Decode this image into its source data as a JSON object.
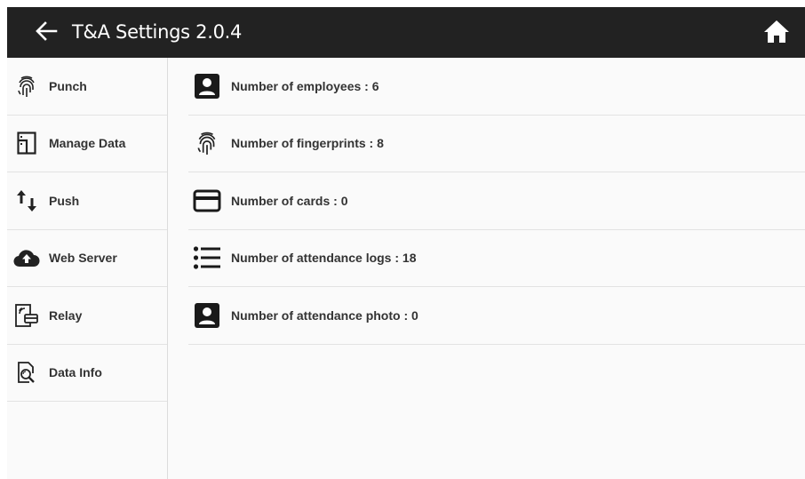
{
  "header": {
    "title": "T&A Settings 2.0.4",
    "back_icon": "arrow-left-icon",
    "home_icon": "home-icon",
    "background": "#222222"
  },
  "sidebar": {
    "items": [
      {
        "label": "Punch",
        "icon": "fingerprint-icon"
      },
      {
        "label": "Manage Data",
        "icon": "storage-icon"
      },
      {
        "label": "Push",
        "icon": "up-down-arrows-icon"
      },
      {
        "label": "Web Server",
        "icon": "cloud-upload-icon"
      },
      {
        "label": "Relay",
        "icon": "door-relay-icon"
      },
      {
        "label": "Data Info",
        "icon": "document-search-icon"
      }
    ]
  },
  "info": {
    "rows": [
      {
        "label": "Number of employees : 6",
        "icon": "contact-card-icon"
      },
      {
        "label": "Number of fingerprints : 8",
        "icon": "fingerprint-icon"
      },
      {
        "label": "Number of cards : 0",
        "icon": "credit-card-icon"
      },
      {
        "label": "Number of attendance logs : 18",
        "icon": "list-icon"
      },
      {
        "label": "Number of attendance photo : 0",
        "icon": "contact-card-icon"
      }
    ]
  }
}
